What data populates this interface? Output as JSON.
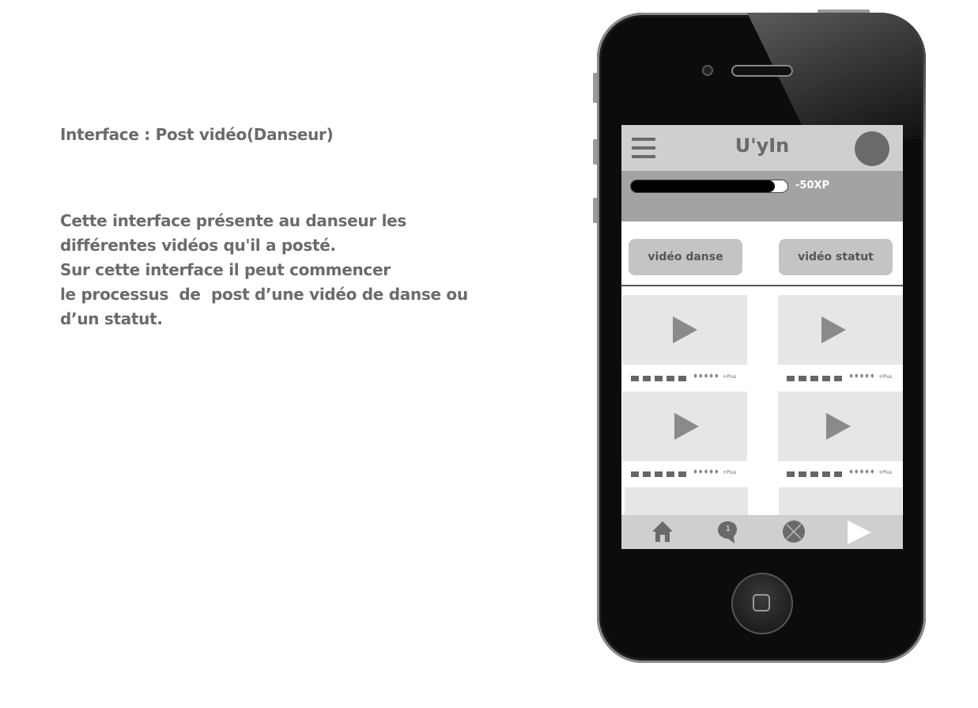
{
  "description": {
    "title": "Interface : Post vidéo(Danseur)",
    "lines": [
      "Cette interface présente au danseur les",
      "différentes vidéos qu'il a posté.",
      "Sur cette interface il peut commencer",
      "le processus  de  post d’une vidéo de danse ou",
      "d’un statut."
    ]
  },
  "app": {
    "title": "U'yIn",
    "xp_label": "-50XP",
    "xp_progress_percent": 92,
    "tabs": {
      "dance_video": "vidéo danse",
      "status_video": "vidéo statut"
    },
    "cards": [
      {
        "more_label": "+Plus",
        "rating": "♦♦♦♦♦"
      },
      {
        "more_label": "+Plus",
        "rating": "♦♦♦♦♦"
      },
      {
        "more_label": "+Plus",
        "rating": "♦♦♦♦♦"
      },
      {
        "more_label": "+Plus",
        "rating": "♦♦♦♦♦"
      }
    ],
    "bottom_nav": {
      "home_icon": "home-icon",
      "notification_icon": "notification-bubble-icon",
      "notification_count": "1",
      "close_icon": "close-circle-icon",
      "play_icon": "play-icon"
    }
  },
  "colors": {
    "text_grey": "#6b6b6b",
    "bar_grey": "#cfcfcf",
    "xp_bar_bg": "#a3a3a3"
  }
}
